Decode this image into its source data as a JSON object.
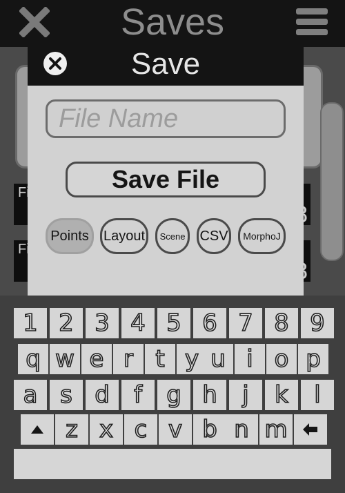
{
  "header": {
    "title": "Saves",
    "close_icon": "close-x-icon",
    "menu_icon": "hamburger-menu-icon"
  },
  "background_list": {
    "rows": [
      {
        "label": "Fi",
        "trailing": "8"
      },
      {
        "label": "Fi",
        "trailing": "8"
      }
    ]
  },
  "dialog": {
    "title": "Save",
    "close_icon": "close-circle-icon",
    "filename_placeholder": "File Name",
    "filename_value": "",
    "save_button_label": "Save File",
    "formats": [
      {
        "label": "Points",
        "selected": true
      },
      {
        "label": "Layout",
        "selected": false
      },
      {
        "label": "Scene",
        "selected": false
      },
      {
        "label": "CSV",
        "selected": false
      },
      {
        "label": "MorphoJ",
        "selected": false
      }
    ]
  },
  "keyboard": {
    "row1": [
      "1",
      "2",
      "3",
      "4",
      "5",
      "6",
      "7",
      "8",
      "9"
    ],
    "row2": [
      "q",
      "w",
      "e",
      "r",
      "t",
      "y",
      "u",
      "i",
      "o",
      "p"
    ],
    "row3": [
      "a",
      "s",
      "d",
      "f",
      "g",
      "h",
      "j",
      "k",
      "l"
    ],
    "row4": [
      "z",
      "x",
      "c",
      "v",
      "b",
      "n",
      "m"
    ],
    "shift_icon": "shift-arrow-icon",
    "backspace_icon": "backspace-icon",
    "spacebar": "space-key"
  },
  "colors": {
    "topbar": "#141414",
    "dialog_bg": "#d2d2d2",
    "keyboard_bg": "#3f3f3f",
    "key_bg": "#d6d6d6"
  }
}
